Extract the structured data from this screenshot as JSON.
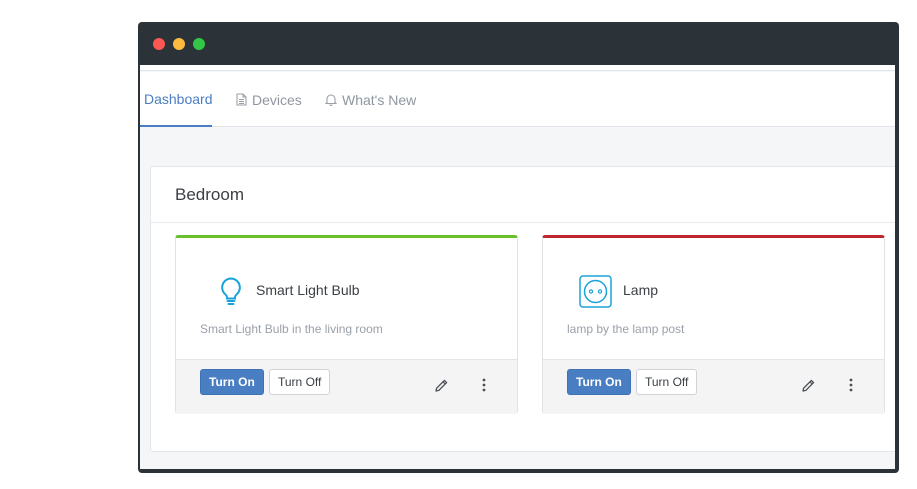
{
  "window": {
    "controls": [
      "close",
      "minimize",
      "maximize"
    ]
  },
  "nav": {
    "tabs": [
      {
        "label": "Dashboard",
        "icon": "",
        "active": true
      },
      {
        "label": "Devices",
        "icon": "document-icon",
        "active": false
      },
      {
        "label": "What's New",
        "icon": "bell-icon",
        "active": false
      }
    ]
  },
  "panel": {
    "title": "Bedroom"
  },
  "devices": [
    {
      "name": "Smart Light Bulb",
      "description": "Smart Light Bulb in the living room",
      "icon": "lightbulb-icon",
      "status_color": "#6abf2a",
      "on_label": "Turn On",
      "off_label": "Turn Off"
    },
    {
      "name": "Lamp",
      "description": "lamp by the lamp post",
      "icon": "power-outlet-icon",
      "status_color": "#c0262d",
      "on_label": "Turn On",
      "off_label": "Turn Off"
    }
  ],
  "colors": {
    "accent": "#4a7ec2",
    "icon": "#1aa3d9"
  }
}
